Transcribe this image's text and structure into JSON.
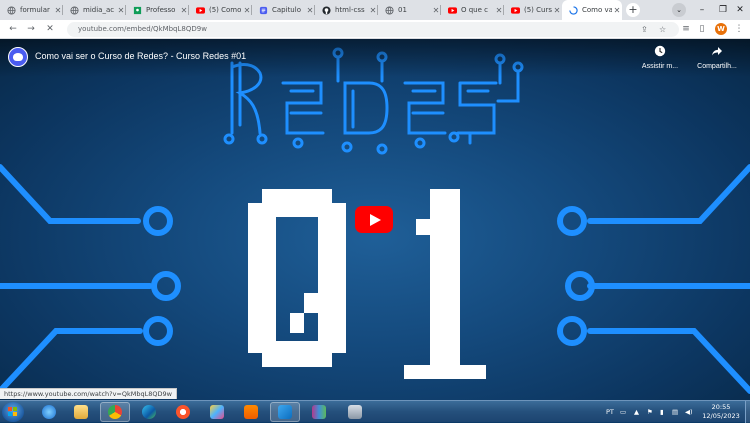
{
  "browser": {
    "tabs": [
      {
        "title": "formular",
        "icon": "globe-icon",
        "active": false
      },
      {
        "title": "midia_ac",
        "icon": "globe-icon",
        "active": false
      },
      {
        "title": "Professo",
        "icon": "classroom-icon",
        "active": false
      },
      {
        "title": "(5) Como",
        "icon": "youtube-icon",
        "active": false
      },
      {
        "title": "Capitulo",
        "icon": "document-icon",
        "active": false
      },
      {
        "title": "html-css",
        "icon": "github-icon",
        "active": false
      },
      {
        "title": "01",
        "icon": "globe-icon",
        "active": false
      },
      {
        "title": "O que c",
        "icon": "youtube-icon",
        "active": false
      },
      {
        "title": "(5) Curs",
        "icon": "youtube-icon",
        "active": false
      },
      {
        "title": "Como va",
        "icon": "loading-icon",
        "active": true
      }
    ],
    "new_tab_label": "+",
    "url": "youtube.com/embed/QkMbqL8QD9w",
    "profile_initial": "W"
  },
  "video": {
    "title": "Como vai ser o Curso de Redes? - Curso Redes #01",
    "watch_later_label": "Assistir m...",
    "share_label": "Compartilh...",
    "art_word": "Redes",
    "art_number": "01",
    "status_url": "https://www.youtube.com/watch?v=QkMbqL8QD9w"
  },
  "taskbar": {
    "apps": [
      "ie-icon",
      "explorer-icon",
      "chrome-icon",
      "edge-icon",
      "brave-icon",
      "vlc-icon",
      "paint-icon",
      "vscode-icon",
      "winrar-icon",
      "network-icon"
    ],
    "language": "PT",
    "time": "20:55",
    "date": "12/05/2023"
  },
  "colors": {
    "accent_red": "#ff0000",
    "circuit_blue": "#1e8fff",
    "video_bg": "#14497c",
    "chrome_tabstrip": "#dee1e6"
  }
}
